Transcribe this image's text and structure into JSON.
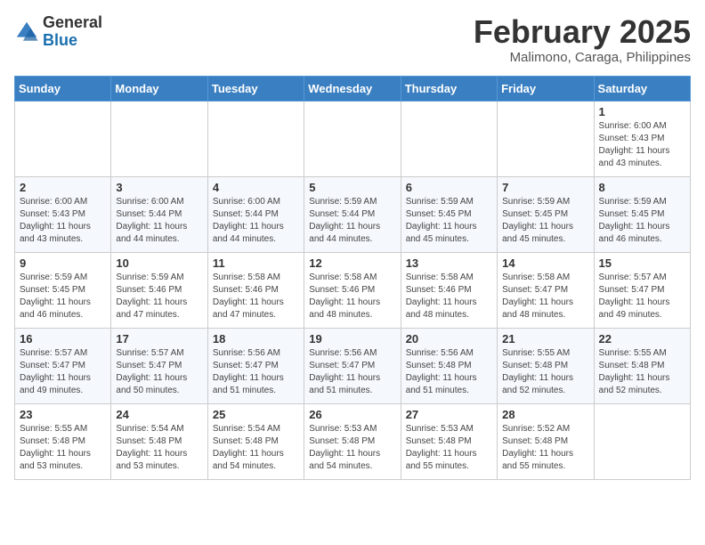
{
  "header": {
    "logo_line1": "General",
    "logo_line2": "Blue",
    "month": "February 2025",
    "location": "Malimono, Caraga, Philippines"
  },
  "days_of_week": [
    "Sunday",
    "Monday",
    "Tuesday",
    "Wednesday",
    "Thursday",
    "Friday",
    "Saturday"
  ],
  "weeks": [
    [
      {
        "day": "",
        "info": ""
      },
      {
        "day": "",
        "info": ""
      },
      {
        "day": "",
        "info": ""
      },
      {
        "day": "",
        "info": ""
      },
      {
        "day": "",
        "info": ""
      },
      {
        "day": "",
        "info": ""
      },
      {
        "day": "1",
        "info": "Sunrise: 6:00 AM\nSunset: 5:43 PM\nDaylight: 11 hours and 43 minutes."
      }
    ],
    [
      {
        "day": "2",
        "info": "Sunrise: 6:00 AM\nSunset: 5:43 PM\nDaylight: 11 hours and 43 minutes."
      },
      {
        "day": "3",
        "info": "Sunrise: 6:00 AM\nSunset: 5:44 PM\nDaylight: 11 hours and 44 minutes."
      },
      {
        "day": "4",
        "info": "Sunrise: 6:00 AM\nSunset: 5:44 PM\nDaylight: 11 hours and 44 minutes."
      },
      {
        "day": "5",
        "info": "Sunrise: 5:59 AM\nSunset: 5:44 PM\nDaylight: 11 hours and 44 minutes."
      },
      {
        "day": "6",
        "info": "Sunrise: 5:59 AM\nSunset: 5:45 PM\nDaylight: 11 hours and 45 minutes."
      },
      {
        "day": "7",
        "info": "Sunrise: 5:59 AM\nSunset: 5:45 PM\nDaylight: 11 hours and 45 minutes."
      },
      {
        "day": "8",
        "info": "Sunrise: 5:59 AM\nSunset: 5:45 PM\nDaylight: 11 hours and 46 minutes."
      }
    ],
    [
      {
        "day": "9",
        "info": "Sunrise: 5:59 AM\nSunset: 5:45 PM\nDaylight: 11 hours and 46 minutes."
      },
      {
        "day": "10",
        "info": "Sunrise: 5:59 AM\nSunset: 5:46 PM\nDaylight: 11 hours and 47 minutes."
      },
      {
        "day": "11",
        "info": "Sunrise: 5:58 AM\nSunset: 5:46 PM\nDaylight: 11 hours and 47 minutes."
      },
      {
        "day": "12",
        "info": "Sunrise: 5:58 AM\nSunset: 5:46 PM\nDaylight: 11 hours and 48 minutes."
      },
      {
        "day": "13",
        "info": "Sunrise: 5:58 AM\nSunset: 5:46 PM\nDaylight: 11 hours and 48 minutes."
      },
      {
        "day": "14",
        "info": "Sunrise: 5:58 AM\nSunset: 5:47 PM\nDaylight: 11 hours and 48 minutes."
      },
      {
        "day": "15",
        "info": "Sunrise: 5:57 AM\nSunset: 5:47 PM\nDaylight: 11 hours and 49 minutes."
      }
    ],
    [
      {
        "day": "16",
        "info": "Sunrise: 5:57 AM\nSunset: 5:47 PM\nDaylight: 11 hours and 49 minutes."
      },
      {
        "day": "17",
        "info": "Sunrise: 5:57 AM\nSunset: 5:47 PM\nDaylight: 11 hours and 50 minutes."
      },
      {
        "day": "18",
        "info": "Sunrise: 5:56 AM\nSunset: 5:47 PM\nDaylight: 11 hours and 51 minutes."
      },
      {
        "day": "19",
        "info": "Sunrise: 5:56 AM\nSunset: 5:47 PM\nDaylight: 11 hours and 51 minutes."
      },
      {
        "day": "20",
        "info": "Sunrise: 5:56 AM\nSunset: 5:48 PM\nDaylight: 11 hours and 51 minutes."
      },
      {
        "day": "21",
        "info": "Sunrise: 5:55 AM\nSunset: 5:48 PM\nDaylight: 11 hours and 52 minutes."
      },
      {
        "day": "22",
        "info": "Sunrise: 5:55 AM\nSunset: 5:48 PM\nDaylight: 11 hours and 52 minutes."
      }
    ],
    [
      {
        "day": "23",
        "info": "Sunrise: 5:55 AM\nSunset: 5:48 PM\nDaylight: 11 hours and 53 minutes."
      },
      {
        "day": "24",
        "info": "Sunrise: 5:54 AM\nSunset: 5:48 PM\nDaylight: 11 hours and 53 minutes."
      },
      {
        "day": "25",
        "info": "Sunrise: 5:54 AM\nSunset: 5:48 PM\nDaylight: 11 hours and 54 minutes."
      },
      {
        "day": "26",
        "info": "Sunrise: 5:53 AM\nSunset: 5:48 PM\nDaylight: 11 hours and 54 minutes."
      },
      {
        "day": "27",
        "info": "Sunrise: 5:53 AM\nSunset: 5:48 PM\nDaylight: 11 hours and 55 minutes."
      },
      {
        "day": "28",
        "info": "Sunrise: 5:52 AM\nSunset: 5:48 PM\nDaylight: 11 hours and 55 minutes."
      },
      {
        "day": "",
        "info": ""
      }
    ]
  ]
}
